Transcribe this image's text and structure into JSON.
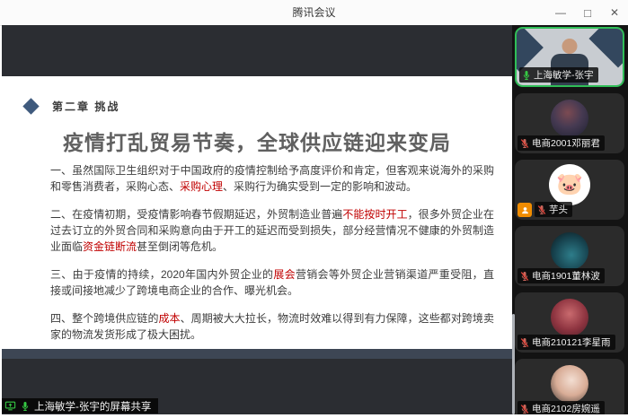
{
  "window": {
    "title": "腾讯会议",
    "controls": {
      "minimize": "—",
      "maximize": "□",
      "close": "✕"
    }
  },
  "screen_share": {
    "banner": "上海敏学-张宇的屏幕共享"
  },
  "slide": {
    "section_label": "第二章 挑战",
    "title": "疫情打乱贸易节奏，全球供应链迎来变局",
    "paragraphs": [
      {
        "segments": [
          {
            "t": "一、虽然国际卫生组织对于中国政府的疫情控制给予高度评价和肯定，但客观来说海外的采购和零售消费者，采购心态、"
          },
          {
            "t": "采购心理",
            "red": true
          },
          {
            "t": "、采购行为确实受到一定的影响和波动。"
          }
        ]
      },
      {
        "segments": [
          {
            "t": "二、在疫情初期，受疫情影响春节假期延迟，外贸制造业普遍"
          },
          {
            "t": "不能按时开工",
            "red": true
          },
          {
            "t": "，很多外贸企业在过去订立的外贸合同和采购意向由于开工的延迟而受到损失，部分经营情况不健康的外贸制造业面临"
          },
          {
            "t": "资金链断流",
            "red": true
          },
          {
            "t": "甚至倒闭等危机。"
          }
        ]
      },
      {
        "segments": [
          {
            "t": "三、由于疫情的持续，2020年国内外贸企业的"
          },
          {
            "t": "展会",
            "red": true
          },
          {
            "t": "营销会等外贸企业营销渠道严重受阻，直接或间接地减少了跨境电商企业的合作、曝光机会。"
          }
        ]
      },
      {
        "segments": [
          {
            "t": "四、整个跨境供应链的"
          },
          {
            "t": "成本",
            "red": true
          },
          {
            "t": "、周期被大大拉长，物流时效难以得到有力保障，这些都对跨境卖家的物流发货形成了极大困扰。"
          }
        ]
      }
    ]
  },
  "participants": [
    {
      "name": "上海敏学-张宇",
      "mic": "on",
      "active": true,
      "avatar": "video"
    },
    {
      "name": "电商2001邓丽君",
      "mic": "muted",
      "active": false,
      "avatar": "photo-dark"
    },
    {
      "name": "芋头",
      "mic": "muted",
      "active": false,
      "avatar": "pig",
      "avatar_glyph": "🐷",
      "badge": "member"
    },
    {
      "name": "电商1901董林波",
      "mic": "muted",
      "active": false,
      "avatar": "car"
    },
    {
      "name": "电商210121李星雨",
      "mic": "muted",
      "active": false,
      "avatar": "anime"
    },
    {
      "name": "电商2102房婉遥",
      "mic": "muted",
      "active": false,
      "avatar": "photo-light"
    }
  ],
  "colors": {
    "active_border": "#2fbe57",
    "mic_active": "#35c943",
    "mic_muted": "#c9675c",
    "mic_slash": "#e8443a",
    "highlight": "#c00000",
    "slide_accent": "#3f5a7d",
    "slide_band": "#3d4654",
    "badge_orange": "#f08c00"
  }
}
